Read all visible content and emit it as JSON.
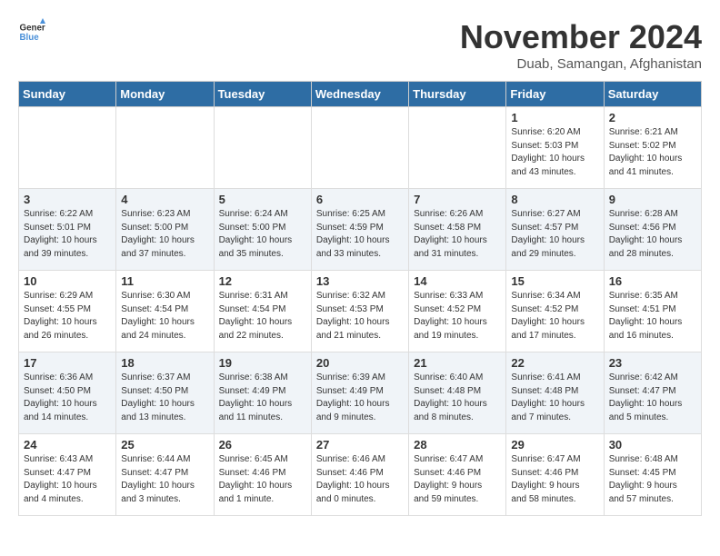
{
  "header": {
    "logo_general": "General",
    "logo_blue": "Blue",
    "month_year": "November 2024",
    "location": "Duab, Samangan, Afghanistan"
  },
  "weekdays": [
    "Sunday",
    "Monday",
    "Tuesday",
    "Wednesday",
    "Thursday",
    "Friday",
    "Saturday"
  ],
  "weeks": [
    [
      {
        "day": "",
        "info": ""
      },
      {
        "day": "",
        "info": ""
      },
      {
        "day": "",
        "info": ""
      },
      {
        "day": "",
        "info": ""
      },
      {
        "day": "",
        "info": ""
      },
      {
        "day": "1",
        "info": "Sunrise: 6:20 AM\nSunset: 5:03 PM\nDaylight: 10 hours\nand 43 minutes."
      },
      {
        "day": "2",
        "info": "Sunrise: 6:21 AM\nSunset: 5:02 PM\nDaylight: 10 hours\nand 41 minutes."
      }
    ],
    [
      {
        "day": "3",
        "info": "Sunrise: 6:22 AM\nSunset: 5:01 PM\nDaylight: 10 hours\nand 39 minutes."
      },
      {
        "day": "4",
        "info": "Sunrise: 6:23 AM\nSunset: 5:00 PM\nDaylight: 10 hours\nand 37 minutes."
      },
      {
        "day": "5",
        "info": "Sunrise: 6:24 AM\nSunset: 5:00 PM\nDaylight: 10 hours\nand 35 minutes."
      },
      {
        "day": "6",
        "info": "Sunrise: 6:25 AM\nSunset: 4:59 PM\nDaylight: 10 hours\nand 33 minutes."
      },
      {
        "day": "7",
        "info": "Sunrise: 6:26 AM\nSunset: 4:58 PM\nDaylight: 10 hours\nand 31 minutes."
      },
      {
        "day": "8",
        "info": "Sunrise: 6:27 AM\nSunset: 4:57 PM\nDaylight: 10 hours\nand 29 minutes."
      },
      {
        "day": "9",
        "info": "Sunrise: 6:28 AM\nSunset: 4:56 PM\nDaylight: 10 hours\nand 28 minutes."
      }
    ],
    [
      {
        "day": "10",
        "info": "Sunrise: 6:29 AM\nSunset: 4:55 PM\nDaylight: 10 hours\nand 26 minutes."
      },
      {
        "day": "11",
        "info": "Sunrise: 6:30 AM\nSunset: 4:54 PM\nDaylight: 10 hours\nand 24 minutes."
      },
      {
        "day": "12",
        "info": "Sunrise: 6:31 AM\nSunset: 4:54 PM\nDaylight: 10 hours\nand 22 minutes."
      },
      {
        "day": "13",
        "info": "Sunrise: 6:32 AM\nSunset: 4:53 PM\nDaylight: 10 hours\nand 21 minutes."
      },
      {
        "day": "14",
        "info": "Sunrise: 6:33 AM\nSunset: 4:52 PM\nDaylight: 10 hours\nand 19 minutes."
      },
      {
        "day": "15",
        "info": "Sunrise: 6:34 AM\nSunset: 4:52 PM\nDaylight: 10 hours\nand 17 minutes."
      },
      {
        "day": "16",
        "info": "Sunrise: 6:35 AM\nSunset: 4:51 PM\nDaylight: 10 hours\nand 16 minutes."
      }
    ],
    [
      {
        "day": "17",
        "info": "Sunrise: 6:36 AM\nSunset: 4:50 PM\nDaylight: 10 hours\nand 14 minutes."
      },
      {
        "day": "18",
        "info": "Sunrise: 6:37 AM\nSunset: 4:50 PM\nDaylight: 10 hours\nand 13 minutes."
      },
      {
        "day": "19",
        "info": "Sunrise: 6:38 AM\nSunset: 4:49 PM\nDaylight: 10 hours\nand 11 minutes."
      },
      {
        "day": "20",
        "info": "Sunrise: 6:39 AM\nSunset: 4:49 PM\nDaylight: 10 hours\nand 9 minutes."
      },
      {
        "day": "21",
        "info": "Sunrise: 6:40 AM\nSunset: 4:48 PM\nDaylight: 10 hours\nand 8 minutes."
      },
      {
        "day": "22",
        "info": "Sunrise: 6:41 AM\nSunset: 4:48 PM\nDaylight: 10 hours\nand 7 minutes."
      },
      {
        "day": "23",
        "info": "Sunrise: 6:42 AM\nSunset: 4:47 PM\nDaylight: 10 hours\nand 5 minutes."
      }
    ],
    [
      {
        "day": "24",
        "info": "Sunrise: 6:43 AM\nSunset: 4:47 PM\nDaylight: 10 hours\nand 4 minutes."
      },
      {
        "day": "25",
        "info": "Sunrise: 6:44 AM\nSunset: 4:47 PM\nDaylight: 10 hours\nand 3 minutes."
      },
      {
        "day": "26",
        "info": "Sunrise: 6:45 AM\nSunset: 4:46 PM\nDaylight: 10 hours\nand 1 minute."
      },
      {
        "day": "27",
        "info": "Sunrise: 6:46 AM\nSunset: 4:46 PM\nDaylight: 10 hours\nand 0 minutes."
      },
      {
        "day": "28",
        "info": "Sunrise: 6:47 AM\nSunset: 4:46 PM\nDaylight: 9 hours\nand 59 minutes."
      },
      {
        "day": "29",
        "info": "Sunrise: 6:47 AM\nSunset: 4:46 PM\nDaylight: 9 hours\nand 58 minutes."
      },
      {
        "day": "30",
        "info": "Sunrise: 6:48 AM\nSunset: 4:45 PM\nDaylight: 9 hours\nand 57 minutes."
      }
    ]
  ]
}
